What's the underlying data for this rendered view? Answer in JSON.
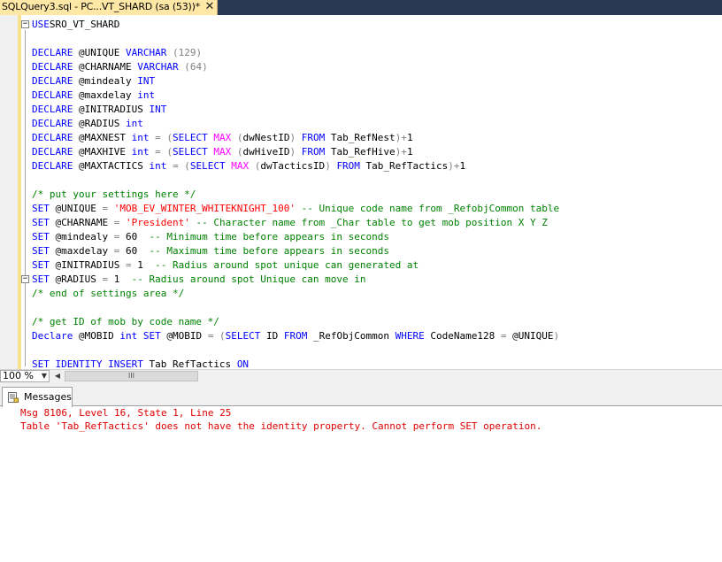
{
  "tab": {
    "title": "SQLQuery3.sql - PC...VT_SHARD (sa (53))*",
    "close_glyph": "✕"
  },
  "editor": {
    "lines": [
      [
        [
          "kw",
          "USE"
        ],
        [
          "",
          "SRO_VT_SHARD"
        ]
      ],
      [],
      [
        [
          "kw",
          "DECLARE"
        ],
        [
          "",
          " @UNIQUE "
        ],
        [
          "kw",
          "VARCHAR"
        ],
        [
          "",
          " "
        ],
        [
          "gr",
          "(129)"
        ]
      ],
      [
        [
          "kw",
          "DECLARE"
        ],
        [
          "",
          " @CHARNAME "
        ],
        [
          "kw",
          "VARCHAR"
        ],
        [
          "",
          " "
        ],
        [
          "gr",
          "(64)"
        ]
      ],
      [
        [
          "kw",
          "DECLARE"
        ],
        [
          "",
          " @mindealy "
        ],
        [
          "kw",
          "INT"
        ]
      ],
      [
        [
          "kw",
          "DECLARE"
        ],
        [
          "",
          " @maxdelay "
        ],
        [
          "kw",
          "int"
        ]
      ],
      [
        [
          "kw",
          "DECLARE"
        ],
        [
          "",
          " @INITRADIUS "
        ],
        [
          "kw",
          "INT"
        ]
      ],
      [
        [
          "kw",
          "DECLARE"
        ],
        [
          "",
          " @RADIUS "
        ],
        [
          "kw",
          "int"
        ]
      ],
      [
        [
          "kw",
          "DECLARE"
        ],
        [
          "",
          " @MAXNEST "
        ],
        [
          "kw",
          "int"
        ],
        [
          "",
          " "
        ],
        [
          "gr",
          "= ("
        ],
        [
          "kw",
          "SELECT"
        ],
        [
          "",
          " "
        ],
        [
          "fn",
          "MAX"
        ],
        [
          "",
          " "
        ],
        [
          "gr",
          "("
        ],
        [
          "",
          "dwNestID"
        ],
        [
          "gr",
          ")"
        ],
        [
          "",
          " "
        ],
        [
          "kw",
          "FROM"
        ],
        [
          "",
          " Tab_RefNest"
        ],
        [
          "gr",
          ")+"
        ],
        [
          "",
          "1"
        ]
      ],
      [
        [
          "kw",
          "DECLARE"
        ],
        [
          "",
          " @MAXHIVE "
        ],
        [
          "kw",
          "int"
        ],
        [
          "",
          " "
        ],
        [
          "gr",
          "= ("
        ],
        [
          "kw",
          "SELECT"
        ],
        [
          "",
          " "
        ],
        [
          "fn",
          "MAX"
        ],
        [
          "",
          " "
        ],
        [
          "gr",
          "("
        ],
        [
          "",
          "dwHiveID"
        ],
        [
          "gr",
          ")"
        ],
        [
          "",
          " "
        ],
        [
          "kw",
          "FROM"
        ],
        [
          "",
          " Tab_RefHive"
        ],
        [
          "gr",
          ")+"
        ],
        [
          "",
          "1"
        ]
      ],
      [
        [
          "kw",
          "DECLARE"
        ],
        [
          "",
          " @MAXTACTICS "
        ],
        [
          "kw",
          "int"
        ],
        [
          "",
          " "
        ],
        [
          "gr",
          "= ("
        ],
        [
          "kw",
          "SELECT"
        ],
        [
          "",
          " "
        ],
        [
          "fn",
          "MAX"
        ],
        [
          "",
          " "
        ],
        [
          "gr",
          "("
        ],
        [
          "",
          "dwTacticsID"
        ],
        [
          "gr",
          ")"
        ],
        [
          "",
          " "
        ],
        [
          "kw",
          "FROM"
        ],
        [
          "",
          " Tab_RefTactics"
        ],
        [
          "gr",
          ")+"
        ],
        [
          "",
          "1"
        ]
      ],
      [],
      [
        [
          "cm",
          "/* put your settings here */"
        ]
      ],
      [
        [
          "kw",
          "SET"
        ],
        [
          "",
          " @UNIQUE "
        ],
        [
          "gr",
          "="
        ],
        [
          "",
          " "
        ],
        [
          "str",
          "'MOB_EV_WINTER_WHITEKNIGHT_100'"
        ],
        [
          "",
          " "
        ],
        [
          "cm",
          "-- Unique code name from _RefobjCommon table"
        ]
      ],
      [
        [
          "kw",
          "SET"
        ],
        [
          "",
          " @CHARNAME "
        ],
        [
          "gr",
          "="
        ],
        [
          "",
          " "
        ],
        [
          "str",
          "'President'"
        ],
        [
          "",
          " "
        ],
        [
          "cm",
          "-- Character name from _Char table to get mob position X Y Z"
        ]
      ],
      [
        [
          "kw",
          "SET"
        ],
        [
          "",
          " @mindealy "
        ],
        [
          "gr",
          "="
        ],
        [
          "",
          " 60  "
        ],
        [
          "cm",
          "-- Minimum time before appears in seconds"
        ]
      ],
      [
        [
          "kw",
          "SET"
        ],
        [
          "",
          " @maxdelay "
        ],
        [
          "gr",
          "="
        ],
        [
          "",
          " 60  "
        ],
        [
          "cm",
          "-- Maximum time before appears in seconds"
        ]
      ],
      [
        [
          "kw",
          "SET"
        ],
        [
          "",
          " @INITRADIUS "
        ],
        [
          "gr",
          "="
        ],
        [
          "",
          " 1  "
        ],
        [
          "cm",
          "-- Radius around spot unique can generated at"
        ]
      ],
      [
        [
          "kw",
          "SET"
        ],
        [
          "",
          " @RADIUS "
        ],
        [
          "gr",
          "="
        ],
        [
          "",
          " 1  "
        ],
        [
          "cm",
          "-- Radius around spot Unique can move in"
        ]
      ],
      [
        [
          "cm",
          "/* end of settings area */"
        ]
      ],
      [],
      [
        [
          "cm",
          "/* get ID of mob by code name */"
        ]
      ],
      [
        [
          "kw",
          "Declare"
        ],
        [
          "",
          " @MOBID "
        ],
        [
          "kw",
          "int"
        ],
        [
          "",
          " "
        ],
        [
          "kw",
          "SET"
        ],
        [
          "",
          " @MOBID "
        ],
        [
          "gr",
          "= ("
        ],
        [
          "kw",
          "SELECT"
        ],
        [
          "",
          " ID "
        ],
        [
          "kw",
          "FROM"
        ],
        [
          "",
          " _RefObjCommon "
        ],
        [
          "kw",
          "WHERE"
        ],
        [
          "",
          " CodeName128 "
        ],
        [
          "gr",
          "="
        ],
        [
          "",
          " @UNIQUE"
        ],
        [
          "gr",
          ")"
        ]
      ],
      [],
      [
        [
          "kw",
          "SET IDENTITY_INSERT"
        ],
        [
          "",
          " Tab_RefTactics "
        ],
        [
          "kw",
          "ON"
        ]
      ]
    ],
    "collapse_glyph": "−"
  },
  "statusbar": {
    "zoom": "100 %",
    "zoom_arrow": "▼",
    "scroll_left_arrow": "◀",
    "scroll_thumb_grip": "III"
  },
  "results": {
    "tab_label": "Messages",
    "messages": [
      "Msg 8106, Level 16, State 1, Line 25",
      "Table 'Tab_RefTactics' does not have the identity property. Cannot perform SET operation."
    ]
  }
}
